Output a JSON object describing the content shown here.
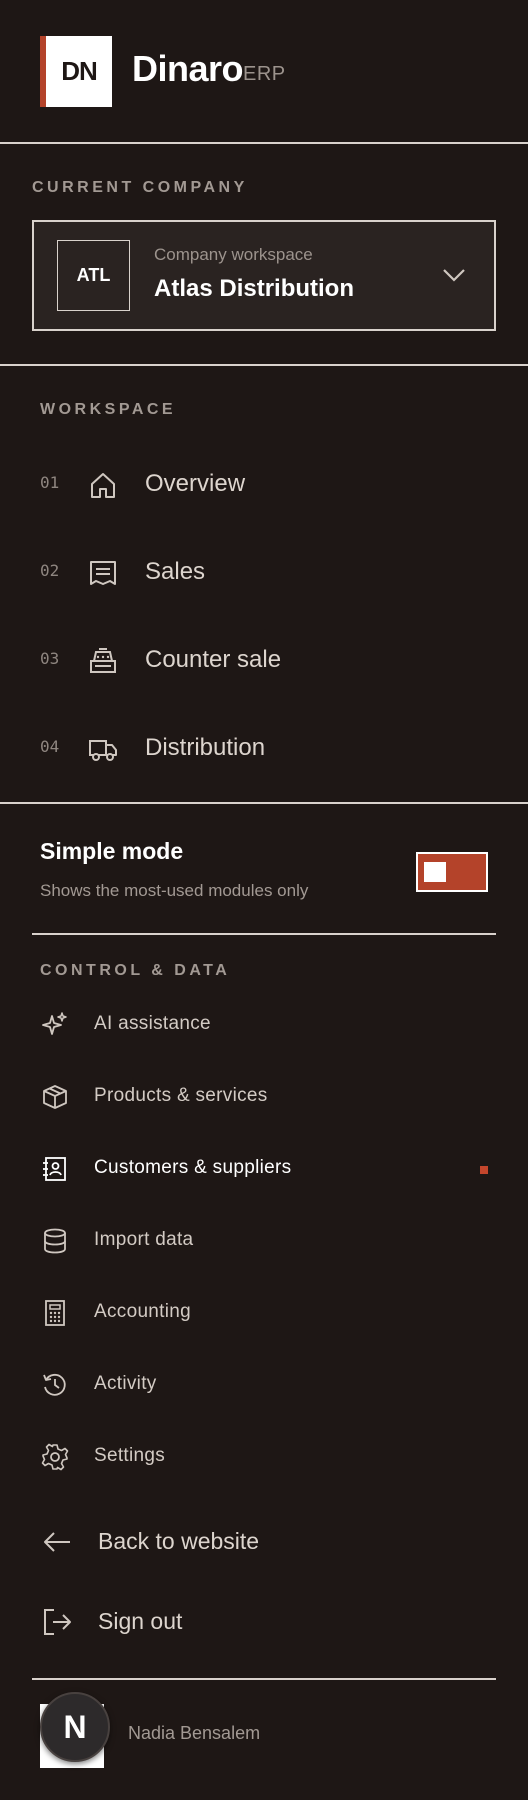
{
  "brand": {
    "logo_text": "DN",
    "name": "Dinaro",
    "suffix": "ERP",
    "accent_color": "#b4432a"
  },
  "company": {
    "section_label": "CURRENT COMPANY",
    "badge": "ATL",
    "caption": "Company workspace",
    "name": "Atlas Distribution",
    "chevron_icon": "chevron-down-icon"
  },
  "workspace": {
    "section_label": "WORKSPACE",
    "items": [
      {
        "num": "01",
        "label": "Overview",
        "icon": "home-icon"
      },
      {
        "num": "02",
        "label": "Sales",
        "icon": "receipt-icon"
      },
      {
        "num": "03",
        "label": "Counter sale",
        "icon": "cash-register-icon"
      },
      {
        "num": "04",
        "label": "Distribution",
        "icon": "truck-icon"
      }
    ]
  },
  "simple_mode": {
    "title": "Simple mode",
    "description": "Shows the most-used modules only",
    "enabled": true
  },
  "control": {
    "section_label": "CONTROL & DATA",
    "items": [
      {
        "label": "AI assistance",
        "icon": "sparkles-icon",
        "active": false
      },
      {
        "label": "Products & services",
        "icon": "box-icon",
        "active": false
      },
      {
        "label": "Customers & suppliers",
        "icon": "contacts-icon",
        "active": true
      },
      {
        "label": "Import data",
        "icon": "database-icon",
        "active": false
      },
      {
        "label": "Accounting",
        "icon": "calculator-icon",
        "active": false
      },
      {
        "label": "Activity",
        "icon": "history-icon",
        "active": false
      },
      {
        "label": "Settings",
        "icon": "gear-icon",
        "active": false
      }
    ]
  },
  "footer": {
    "back_label": "Back to website",
    "signout_label": "Sign out"
  },
  "user": {
    "avatar_letter": "N",
    "name": "Nadia Bensalem"
  }
}
